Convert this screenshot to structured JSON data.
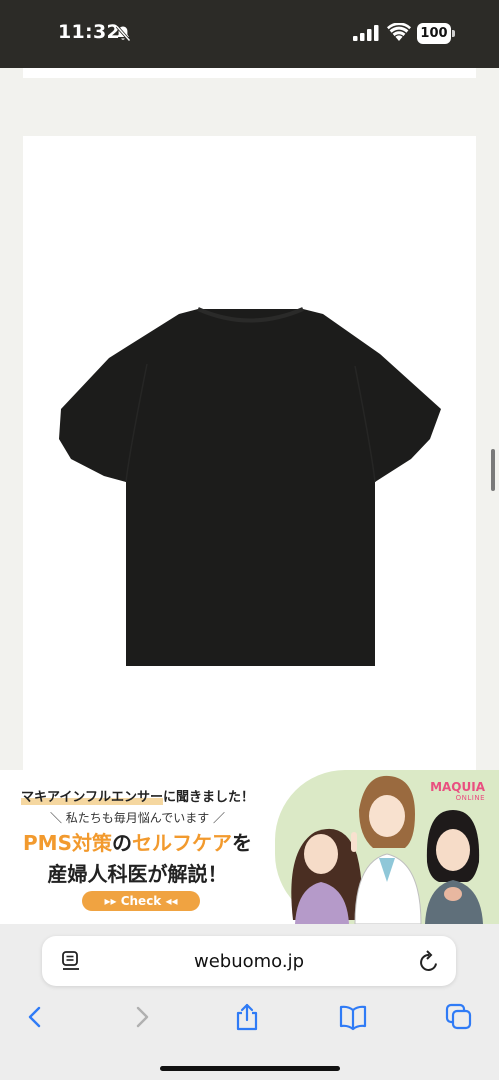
{
  "status_bar": {
    "time": "11:32",
    "battery": "100",
    "icons": [
      "bell-slash-icon",
      "signal-icon",
      "wifi-icon",
      "battery-icon"
    ]
  },
  "product": {
    "image": "black-tshirt-back"
  },
  "ad": {
    "line1_highlight": "マキアインフルエンサー",
    "line1_rest": "に聞きました！",
    "line2": "＼ 私たちも毎月悩んでいます ／",
    "line3_a": "PMS対策",
    "line3_b": "の",
    "line3_c": "セルフケア",
    "line3_d": "を",
    "line4": "産婦人科医が解説！",
    "check_button": "▸▸ Check ◂◂",
    "logo_main": "MAQUIA",
    "logo_sub": "ONLINE",
    "colors": {
      "accent": "#f29a2e",
      "logo": "#e94f80",
      "illustration_bg": "#dbe9c6"
    }
  },
  "browser": {
    "url": "webuomo.jp",
    "icons": [
      "reader-icon",
      "reload-icon",
      "back-icon",
      "forward-icon",
      "share-icon",
      "bookmarks-icon",
      "tabs-icon"
    ],
    "colors": {
      "accent": "#2f7bf6",
      "disabled": "#b0b0b0"
    }
  }
}
